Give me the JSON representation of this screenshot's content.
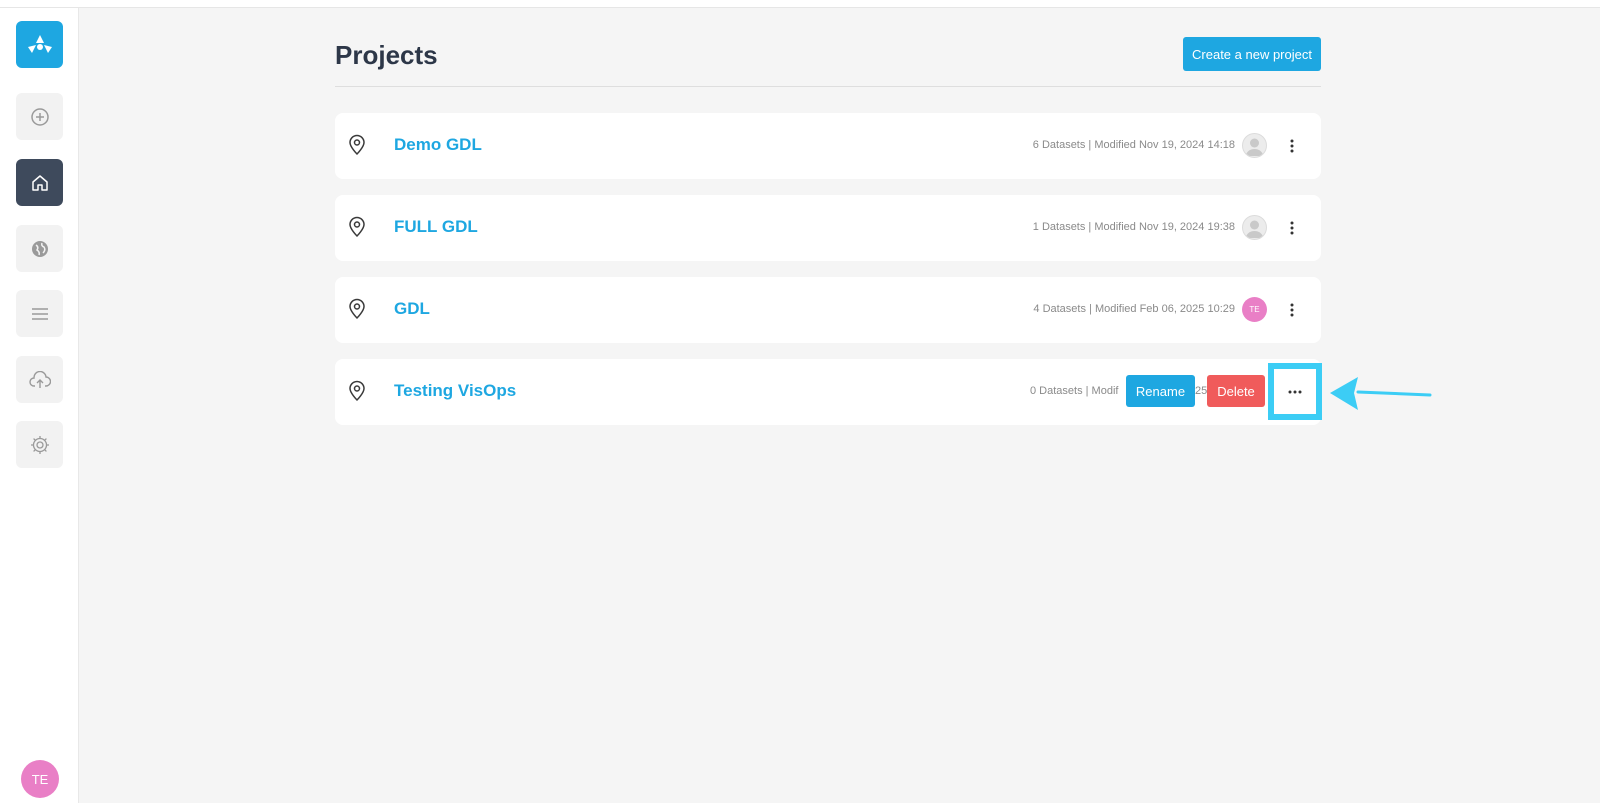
{
  "page": {
    "title": "Projects",
    "create_label": "Create a new project"
  },
  "sidebar": {
    "items": [
      {
        "icon": "logo-icon"
      },
      {
        "icon": "plus-circle-icon"
      },
      {
        "icon": "home-icon",
        "active": true
      },
      {
        "icon": "globe-icon"
      },
      {
        "icon": "menu-icon"
      },
      {
        "icon": "upload-cloud-icon"
      },
      {
        "icon": "gear-icon"
      }
    ],
    "user_initials": "TE"
  },
  "projects": [
    {
      "name": "Demo GDL",
      "meta": "6 Datasets | Modified Nov 19, 2024 14:18",
      "owner": "default-avatar"
    },
    {
      "name": "FULL GDL",
      "meta": "1 Datasets | Modified Nov 19, 2024 19:38",
      "owner": "default-avatar"
    },
    {
      "name": "GDL",
      "meta": "4 Datasets | Modified Feb 06, 2025 10:29",
      "owner_initials": "TE"
    },
    {
      "name": "Testing VisOps",
      "meta_visible": "0 Datasets | Modif",
      "meta_faded": "25",
      "rename_label": "Rename",
      "delete_label": "Delete"
    }
  ],
  "colors": {
    "accent": "#1ea7e1",
    "danger": "#f05b5b",
    "highlight": "#3ccdf5",
    "avatar_pink": "#e97fc6",
    "sidebar_active": "#3e4a5c"
  }
}
